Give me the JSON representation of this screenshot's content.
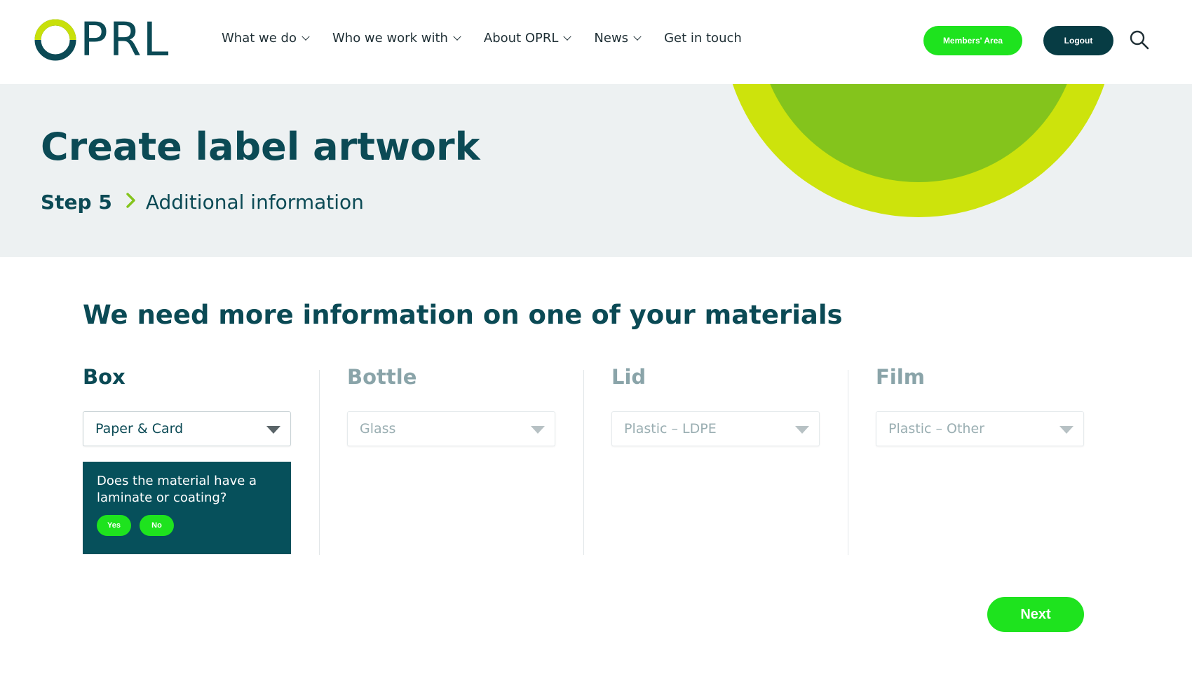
{
  "header": {
    "logo_text": "PRL",
    "nav": [
      {
        "label": "What we do",
        "has_dropdown": true
      },
      {
        "label": "Who we work with",
        "has_dropdown": true
      },
      {
        "label": "About OPRL",
        "has_dropdown": true
      },
      {
        "label": "News",
        "has_dropdown": true
      },
      {
        "label": "Get in touch",
        "has_dropdown": false
      }
    ],
    "members_label": "Members' Area",
    "logout_label": "Logout",
    "search_icon": "search-icon"
  },
  "hero": {
    "title": "Create label artwork",
    "step_number": "Step 5",
    "step_name": "Additional information"
  },
  "main": {
    "title": "We need more information on one of your materials",
    "materials": [
      {
        "name": "Box",
        "selected": "Paper & Card",
        "active": true
      },
      {
        "name": "Bottle",
        "selected": "Glass",
        "active": false
      },
      {
        "name": "Lid",
        "selected": "Plastic – LDPE",
        "active": false
      },
      {
        "name": "Film",
        "selected": "Plastic – Other",
        "active": false
      }
    ],
    "question": {
      "text": "Does the material have a laminate or coating?",
      "yes_label": "Yes",
      "no_label": "No"
    },
    "next_label": "Next"
  },
  "colors": {
    "brand_dark": "#0b4a55",
    "brand_green": "#1ee31e",
    "logo_lime": "#c8e00a",
    "hero_bg": "#edf1f2",
    "deco_outer": "#cde30c",
    "deco_inner": "#84c41c"
  }
}
